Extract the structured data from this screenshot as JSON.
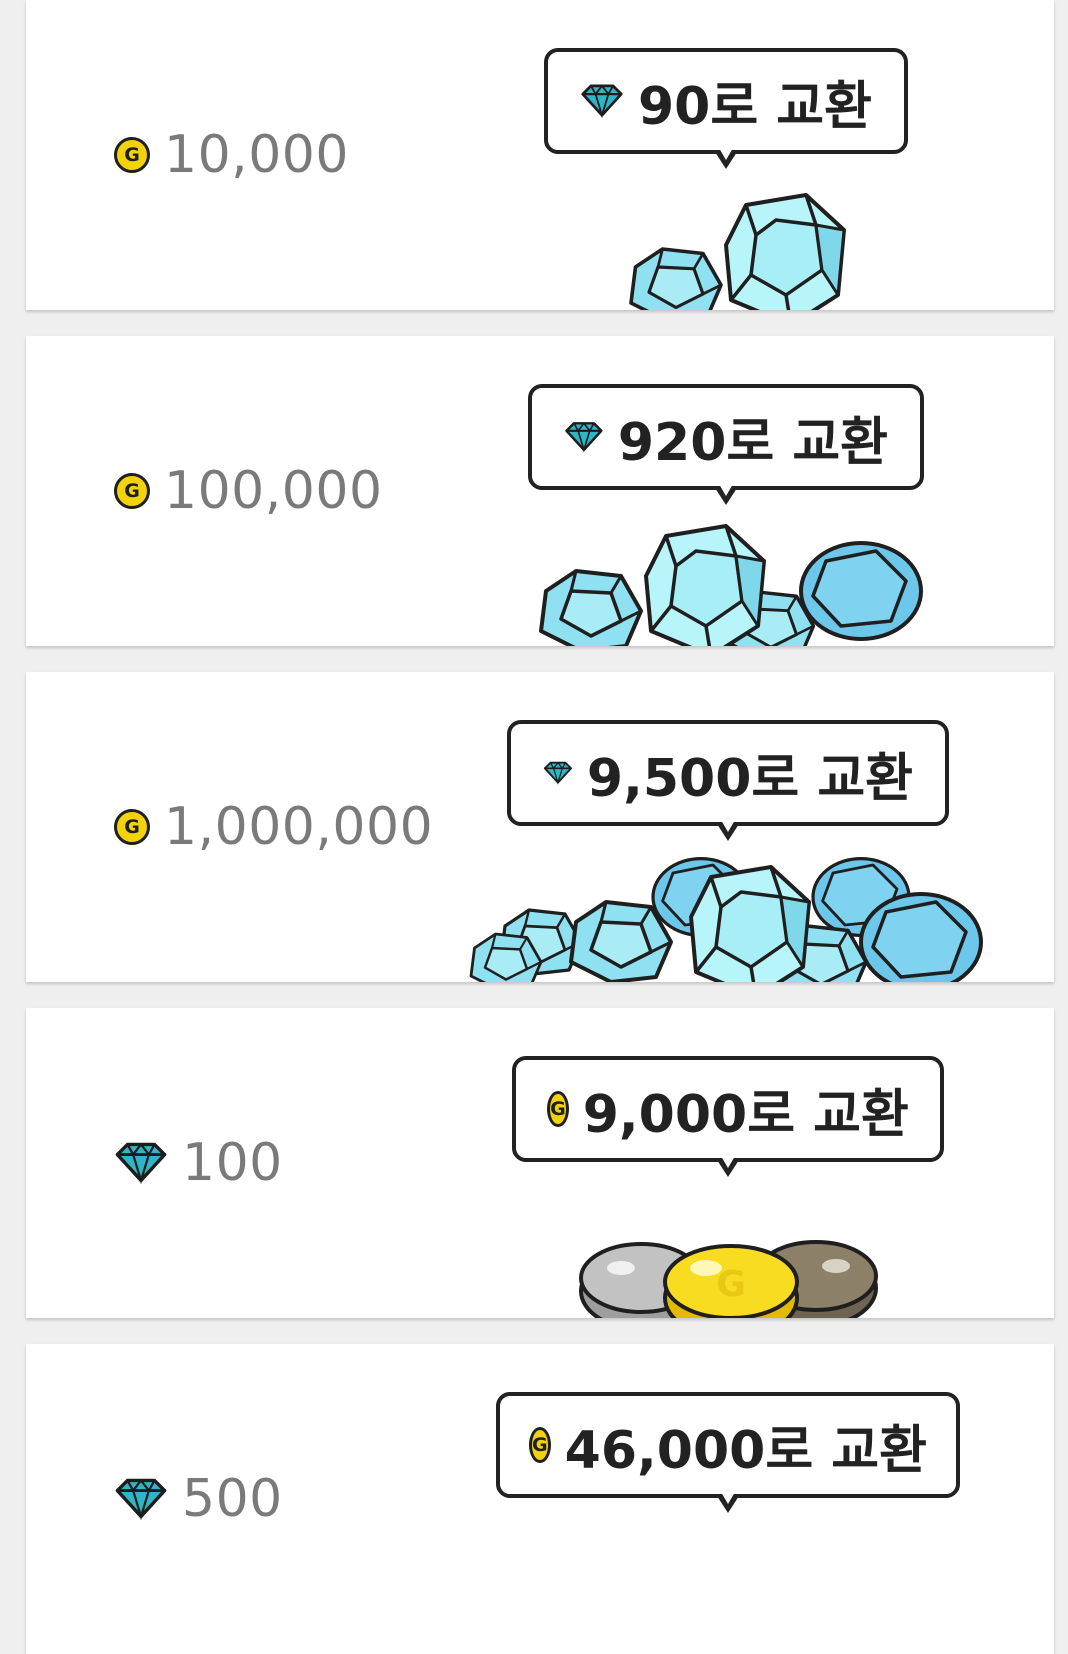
{
  "colors": {
    "gem": "#2fb6c6",
    "gem_light": "#b8f5fa",
    "gem_mid": "#8fe0f0",
    "gem_dark": "#6cc7ea",
    "coin_gold": "#f2d20d",
    "coin_silver": "#c2c2c2",
    "coin_bronze": "#8d8069",
    "text_gray": "#7a7a7a",
    "outline": "#222222"
  },
  "items": [
    {
      "cost_icon": "coin-icon",
      "cost": "10,000",
      "reward_icon": "gem-icon",
      "reward_label": "90로 교환"
    },
    {
      "cost_icon": "coin-icon",
      "cost": "100,000",
      "reward_icon": "gem-icon",
      "reward_label": "920로 교환"
    },
    {
      "cost_icon": "coin-icon",
      "cost": "1,000,000",
      "reward_icon": "gem-icon",
      "reward_label": "9,500로 교환"
    },
    {
      "cost_icon": "gem-icon",
      "cost": "100",
      "reward_icon": "coin-icon",
      "reward_label": "9,000로 교환"
    },
    {
      "cost_icon": "gem-icon",
      "cost": "500",
      "reward_icon": "coin-icon",
      "reward_label": "46,000로 교환"
    }
  ],
  "coin_letter": "G"
}
